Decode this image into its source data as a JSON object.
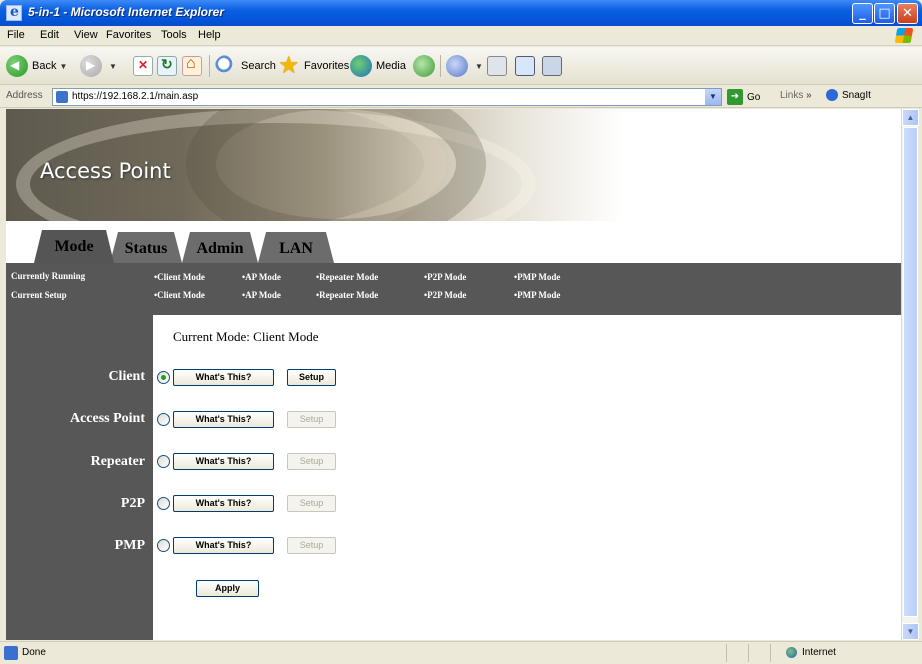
{
  "window": {
    "title": "5-in-1 - Microsoft Internet Explorer",
    "min": "_",
    "max": "□",
    "close": "✕"
  },
  "menu": [
    "File",
    "Edit",
    "View",
    "Favorites",
    "Tools",
    "Help"
  ],
  "toolbar": {
    "back": "Back",
    "search": "Search",
    "favorites": "Favorites",
    "media": "Media"
  },
  "address": {
    "label": "Address",
    "url": "https://192.168.2.1/main.asp",
    "go": "Go",
    "links": "Links",
    "links_chevron": "»",
    "snagit": "SnagIt"
  },
  "banner": {
    "title": "Access Point"
  },
  "tabs": [
    "Mode",
    "Status",
    "Admin",
    "LAN"
  ],
  "status_strip": {
    "currently_running_label": "Currently Running",
    "current_setup_label": "Current Setup",
    "modes": [
      "•Client Mode",
      "•AP Mode",
      "•Repeater Mode",
      "•P2P Mode",
      "•PMP Mode"
    ]
  },
  "main": {
    "current_mode": "Current Mode: Client Mode",
    "whats_this": "What's This?",
    "setup": "Setup",
    "apply": "Apply",
    "modes": [
      {
        "label": "Client",
        "checked": true,
        "setup_enabled": true
      },
      {
        "label": "Access Point",
        "checked": false,
        "setup_enabled": false
      },
      {
        "label": "Repeater",
        "checked": false,
        "setup_enabled": false
      },
      {
        "label": "P2P",
        "checked": false,
        "setup_enabled": false
      },
      {
        "label": "PMP",
        "checked": false,
        "setup_enabled": false
      }
    ]
  },
  "statusbar": {
    "text": "Done",
    "zone": "Internet"
  }
}
